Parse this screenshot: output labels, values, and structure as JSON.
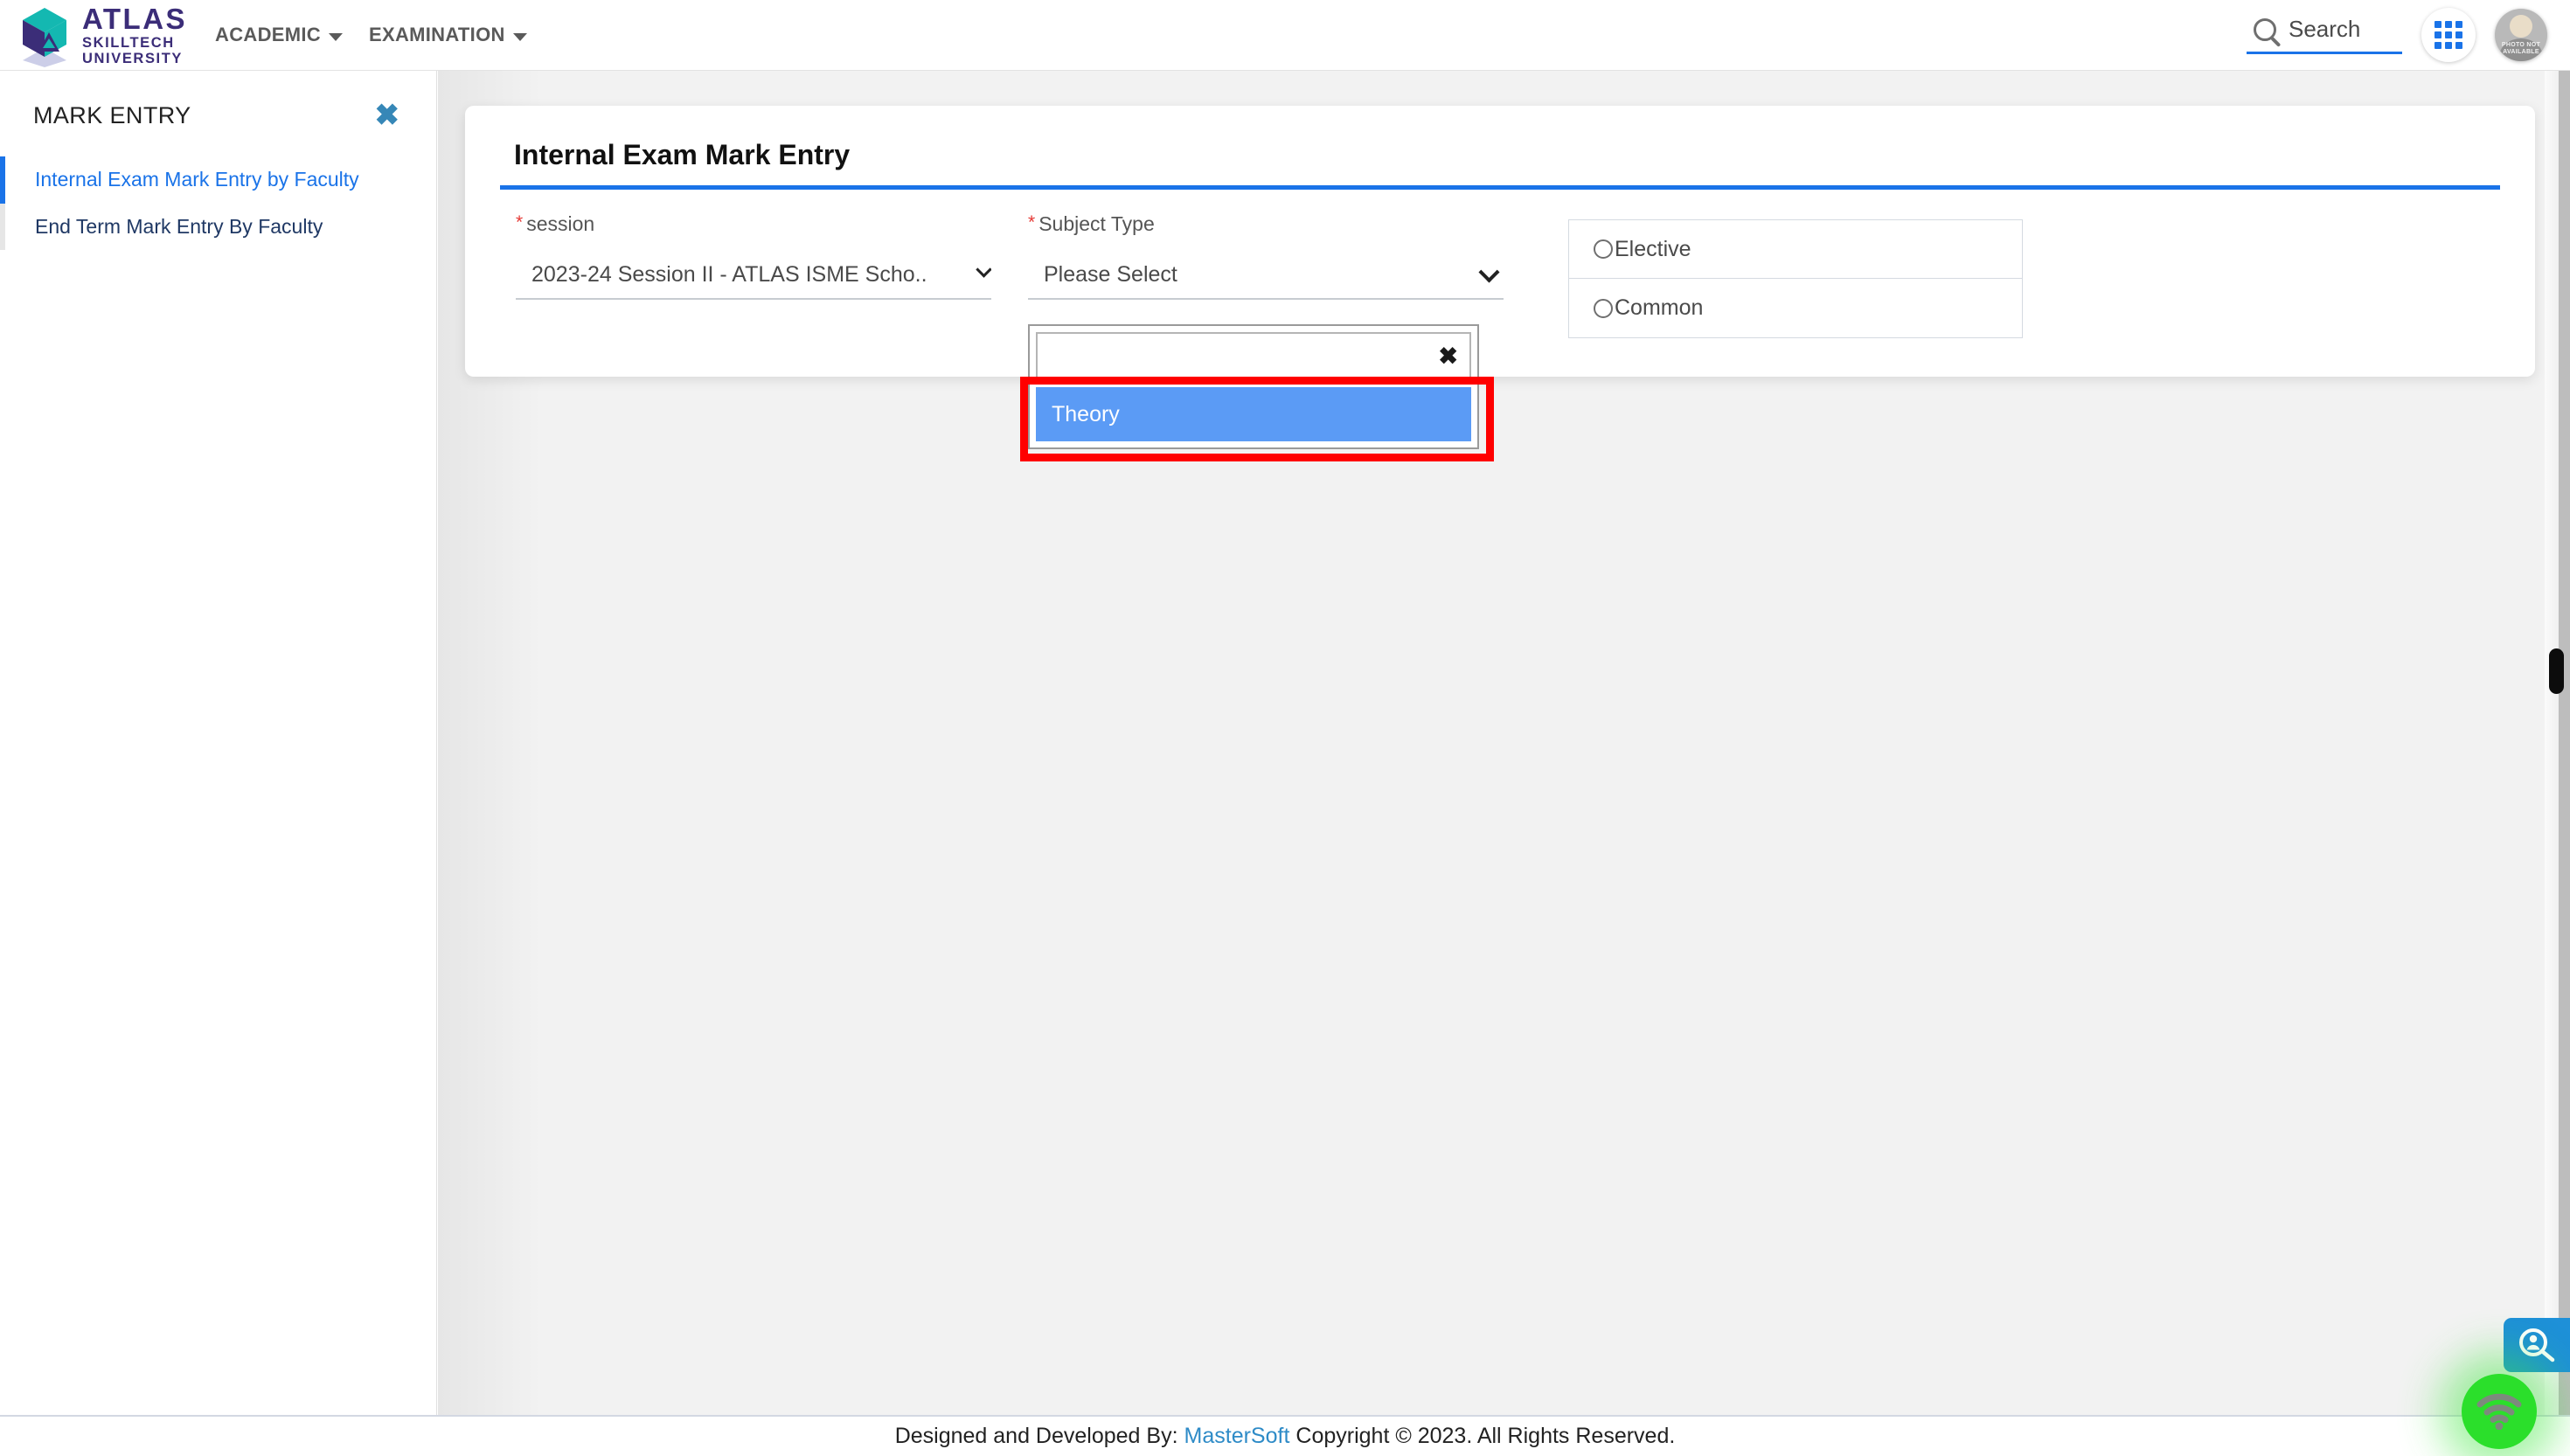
{
  "header": {
    "logo": {
      "line1": "ATLAS",
      "line2": "SKILLTECH",
      "line3": "UNIVERSITY"
    },
    "nav": [
      {
        "label": "ACADEMIC"
      },
      {
        "label": "EXAMINATION"
      }
    ],
    "search_label": "Search",
    "apps_icon": "grid-apps-icon",
    "avatar_text": "PHOTO NOT AVAILABLE"
  },
  "sidebar": {
    "title": "MARK ENTRY",
    "close_icon": "close-icon",
    "items": [
      {
        "label": "Internal Exam Mark Entry by Faculty",
        "active": true
      },
      {
        "label": "End Term Mark Entry By Faculty",
        "active": false
      }
    ]
  },
  "main": {
    "card_title": "Internal Exam Mark Entry",
    "fields": {
      "session": {
        "label": "session",
        "required_marker": "*",
        "value": "2023-24 Session II - ATLAS ISME Scho.."
      },
      "subject_type": {
        "label": "Subject Type",
        "required_marker": "*",
        "value": "Please Select",
        "search_value": "",
        "clear_icon": "clear-x-icon",
        "options": [
          {
            "label": "Theory",
            "highlighted": true
          }
        ]
      }
    },
    "radio_group": {
      "options": [
        {
          "label": "Elective",
          "selected": false
        },
        {
          "label": "Common",
          "selected": false
        }
      ]
    }
  },
  "footer": {
    "prefix": "Designed and Developed By:",
    "link": "MasterSoft",
    "suffix": "Copyright © 2023. All Rights Reserved."
  },
  "widgets": {
    "person_search_icon": "person-search-icon",
    "wifi_icon": "wifi-signal-icon"
  },
  "colors": {
    "accent_blue": "#1a73e8",
    "brand_purple": "#3b2d78",
    "brand_teal": "#14b8b1",
    "highlight_red": "#ff0000",
    "option_blue": "#5b9bf5",
    "link_blue": "#2e8bc7"
  }
}
